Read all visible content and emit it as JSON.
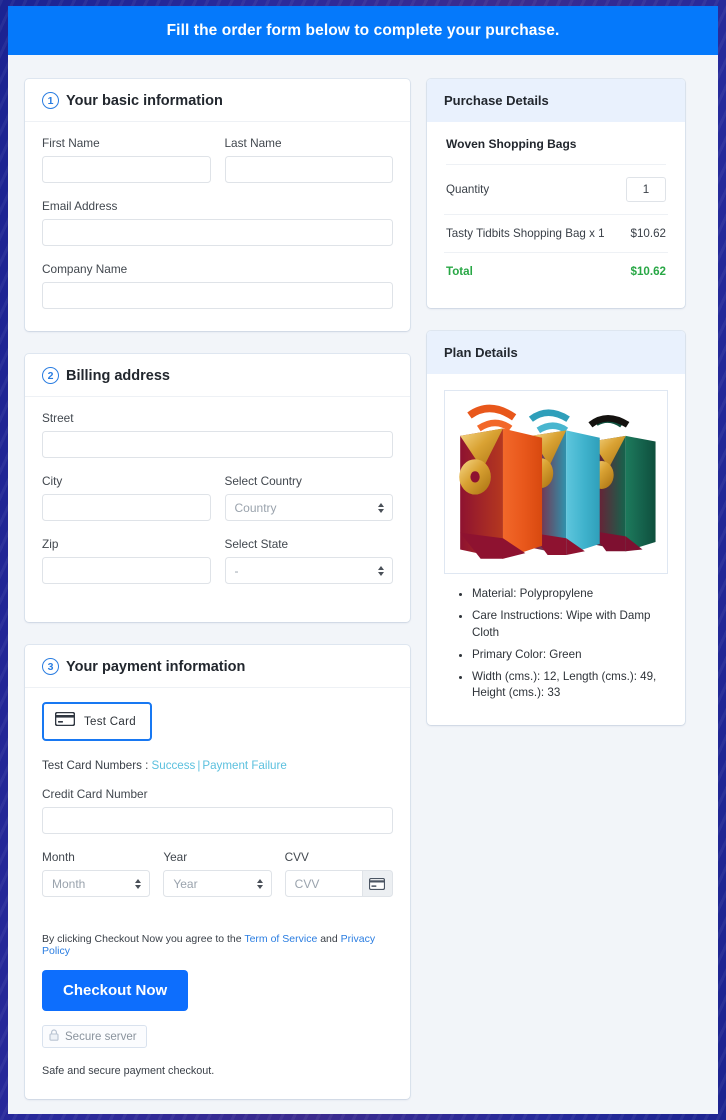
{
  "banner": {
    "text": "Fill the order form below to complete your purchase."
  },
  "colors": {
    "accent_blue": "#0d6efd",
    "banner_blue": "#0579fb",
    "panel_head_blue": "#e9f1fd",
    "total_green": "#28a745",
    "link_teal": "#5bc0de",
    "frame_navy": "#1f2a9e"
  },
  "basic_info": {
    "step": "1",
    "title": "Your basic information",
    "fields": [
      {
        "label": "First Name",
        "value": "",
        "placeholder": ""
      },
      {
        "label": "Last Name",
        "value": "",
        "placeholder": ""
      },
      {
        "label": "Email Address",
        "value": "",
        "placeholder": ""
      },
      {
        "label": "Company Name",
        "value": "",
        "placeholder": ""
      }
    ]
  },
  "billing": {
    "step": "2",
    "title": "Billing address",
    "street_label": "Street",
    "city_label": "City",
    "country_label": "Select Country",
    "country_value": "Country",
    "zip_label": "Zip",
    "state_label": "Select State",
    "state_value": "-"
  },
  "payment": {
    "step": "3",
    "title": "Your payment information",
    "card_tab_label": "Test  Card",
    "card_tab_icon": "credit-card-icon",
    "test_numbers_prefix": "Test Card Numbers : ",
    "test_success_link": "Success",
    "test_separator": "|",
    "test_failure_link": "Payment Failure",
    "cc_label": "Credit Card Number",
    "cc_value": "",
    "month_label": "Month",
    "month_value": "Month",
    "year_label": "Year",
    "year_value": "Year",
    "cvv_label": "CVV",
    "cvv_placeholder": "CVV",
    "cvv_addon_icon": "credit-card-icon",
    "terms_prefix": "By clicking Checkout Now you agree to the ",
    "terms_link": "Term of Service",
    "terms_and": " and ",
    "privacy_link": "Privacy Policy",
    "checkout_label": "Checkout Now",
    "secure_badge_label": "Secure server",
    "secure_badge_icon": "lock-icon",
    "safe_note": "Safe and secure payment checkout."
  },
  "purchase_details": {
    "title": "Purchase Details",
    "product_name": "Woven Shopping Bags",
    "quantity_label": "Quantity",
    "quantity_value": "1",
    "line_item_label": "Tasty Tidbits Shopping Bag x 1",
    "line_item_amount": "$10.62",
    "total_label": "Total",
    "total_amount": "$10.62"
  },
  "plan_details": {
    "title": "Plan Details",
    "image_alt": "three woven shopping bags orange blue green with gold bows",
    "specs": [
      "Material: Polypropylene",
      "Care Instructions: Wipe with Damp Cloth",
      "Primary Color: Green",
      "Width (cms.): 12, Length (cms.): 49, Height (cms.): 33"
    ]
  }
}
